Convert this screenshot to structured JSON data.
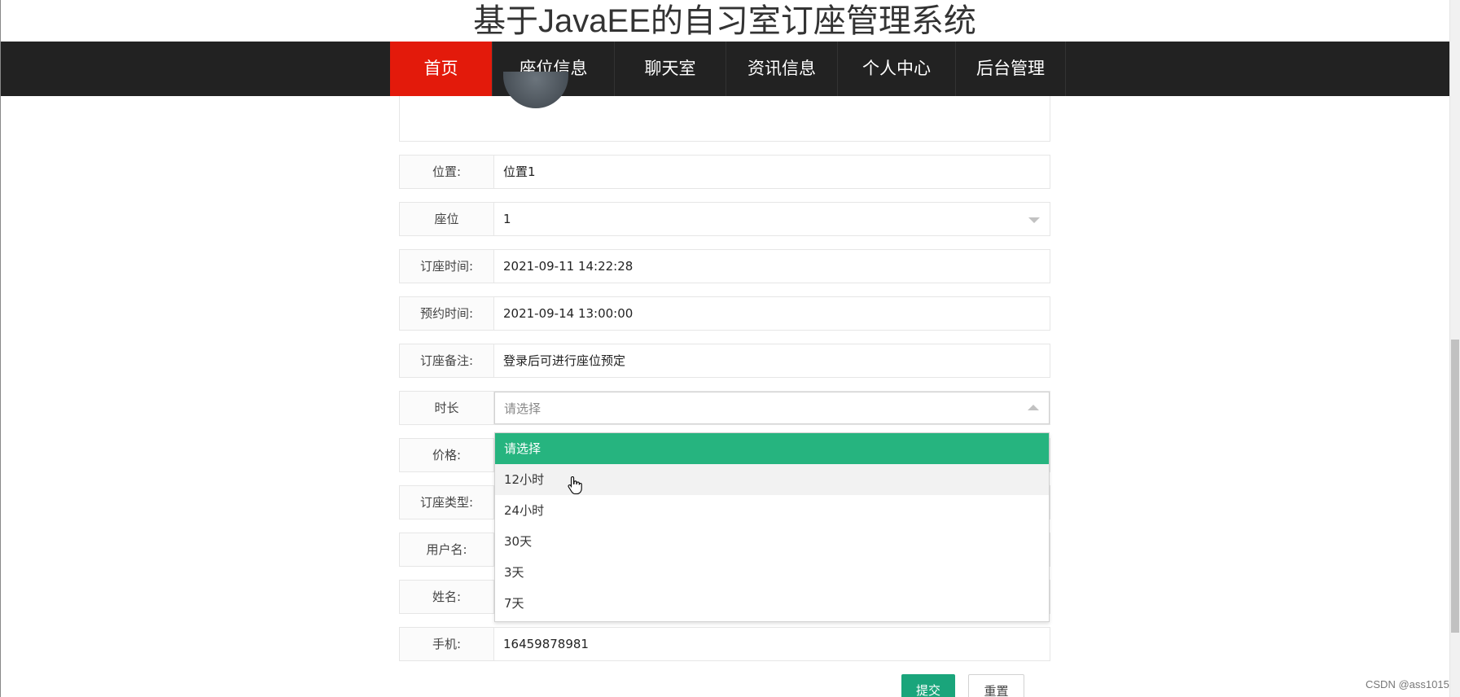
{
  "page": {
    "title": "基于JavaEE的自习室订座管理系统"
  },
  "nav": {
    "items": [
      {
        "label": "首页",
        "active": true
      },
      {
        "label": "座位信息"
      },
      {
        "label": "聊天室"
      },
      {
        "label": "资讯信息"
      },
      {
        "label": "个人中心"
      },
      {
        "label": "后台管理"
      }
    ]
  },
  "form": {
    "location": {
      "label": "位置:",
      "value": "位置1"
    },
    "seat": {
      "label": "座位",
      "value": "1"
    },
    "order_time": {
      "label": "订座时间:",
      "value": "2021-09-11 14:22:28"
    },
    "reserve_time": {
      "label": "预约时间:",
      "value": "2021-09-14 13:00:00"
    },
    "note": {
      "label": "订座备注:",
      "value": "登录后可进行座位预定"
    },
    "duration": {
      "label": "时长",
      "placeholder": "请选择",
      "options": [
        "请选择",
        "12小时",
        "24小时",
        "30天",
        "3天",
        "7天"
      ]
    },
    "price": {
      "label": "价格:"
    },
    "order_type": {
      "label": "订座类型:"
    },
    "username": {
      "label": "用户名:"
    },
    "name": {
      "label": "姓名:"
    },
    "phone": {
      "label": "手机:",
      "value": "16459878981"
    },
    "submit_label": "提交",
    "reset_label": "重置"
  },
  "watermark": "CSDN @ass1015",
  "colors": {
    "nav_active": "#e31a0b",
    "option_selected": "#26b47f",
    "submit": "#1aa57b"
  }
}
